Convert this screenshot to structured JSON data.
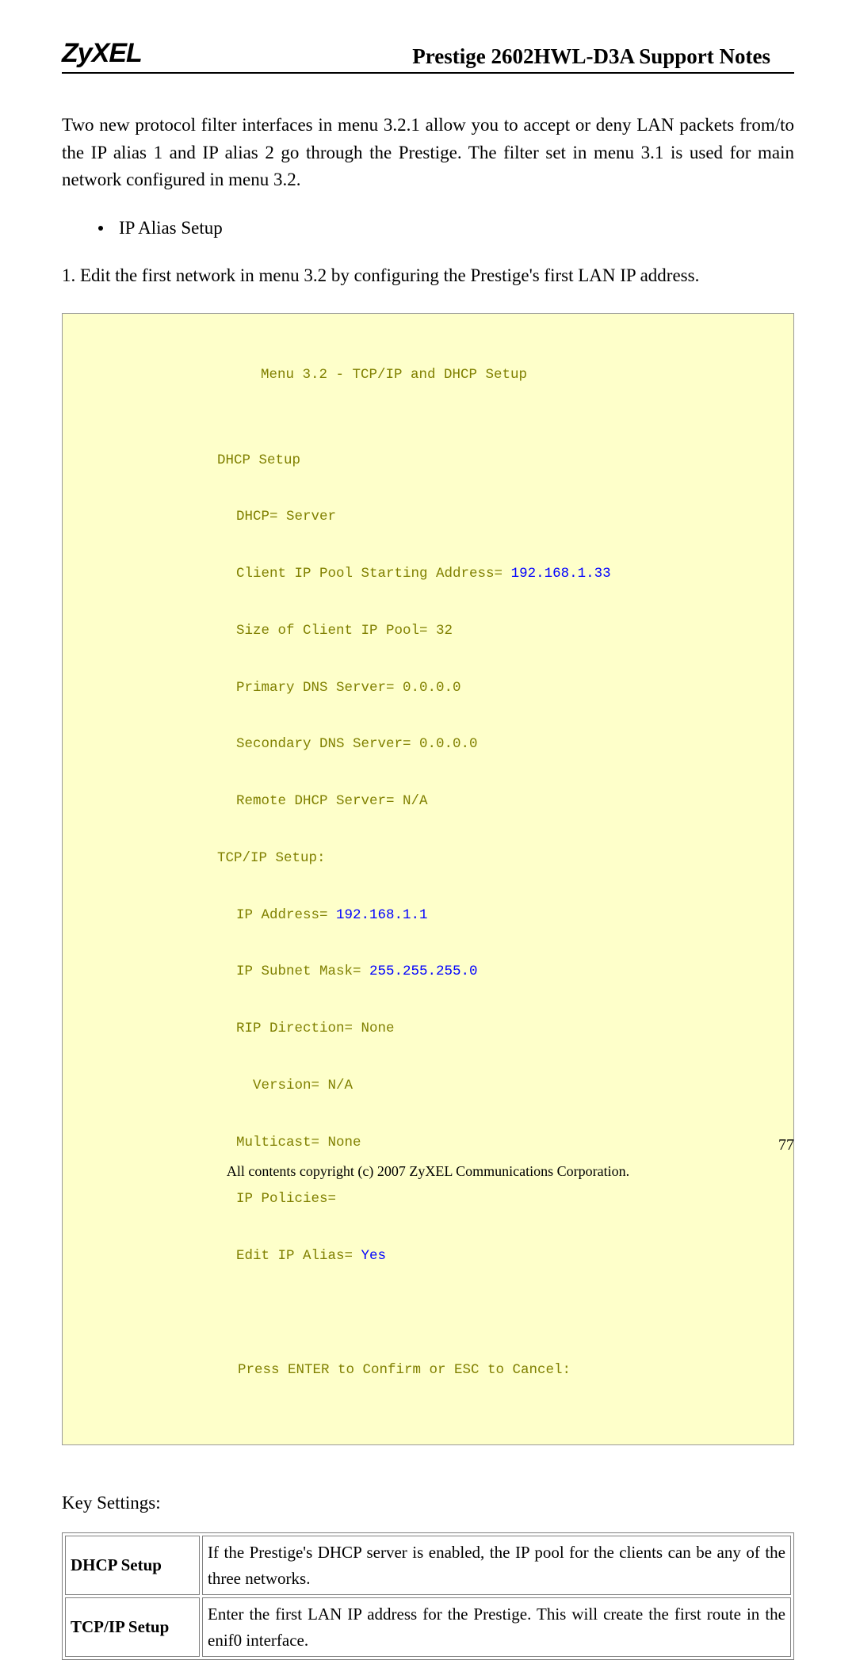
{
  "header": {
    "logo": "ZyXEL",
    "title": "Prestige 2602HWL-D3A Support Notes"
  },
  "intro_para": "Two new protocol filter interfaces in menu 3.2.1 allow you to accept or deny LAN packets from/to the IP alias 1 and IP alias 2 go through the Prestige. The filter set in menu 3.1 is used for main network configured in menu 3.2.",
  "bullet": "IP Alias Setup",
  "step1": "1. Edit the first network in menu 3.2 by configuring the Prestige's first LAN IP address.",
  "terminal": {
    "title": "Menu 3.2 - TCP/IP and DHCP Setup",
    "dhcp_setup": "DHCP Setup",
    "dhcp": "DHCP= Server",
    "client_pool_label": "Client IP Pool Starting Address= ",
    "client_pool_val": "192.168.1.33",
    "pool_size": "Size of Client IP Pool= 32",
    "primary_dns": "Primary DNS Server= 0.0.0.0",
    "secondary_dns": "Secondary DNS Server= 0.0.0.0",
    "remote_dhcp": "Remote DHCP Server= N/A",
    "tcpip_setup": "TCP/IP Setup:",
    "ip_addr_label": "IP Address= ",
    "ip_addr_val": "192.168.1.1",
    "subnet_label": "IP Subnet Mask= ",
    "subnet_val": "255.255.255.0",
    "rip_dir": "RIP Direction= None",
    "version": "Version= N/A",
    "multicast": "Multicast= None",
    "ip_policies": "IP Policies=",
    "edit_alias_label": "Edit IP Alias= ",
    "edit_alias_val": "Yes",
    "prompt": "Press ENTER to Confirm or ESC to Cancel:"
  },
  "key_settings_heading": "Key Settings:",
  "table": {
    "row1_label": "DHCP Setup",
    "row1_desc": "If the Prestige's DHCP server is enabled, the IP pool for the clients can be any of the three networks.",
    "row2_label": "TCP/IP Setup",
    "row2_desc": "Enter the first LAN IP address for the Prestige. This will create the first route in the enif0 interface."
  },
  "page_number": "77",
  "footer": "All contents copyright (c) 2007 ZyXEL Communications Corporation."
}
